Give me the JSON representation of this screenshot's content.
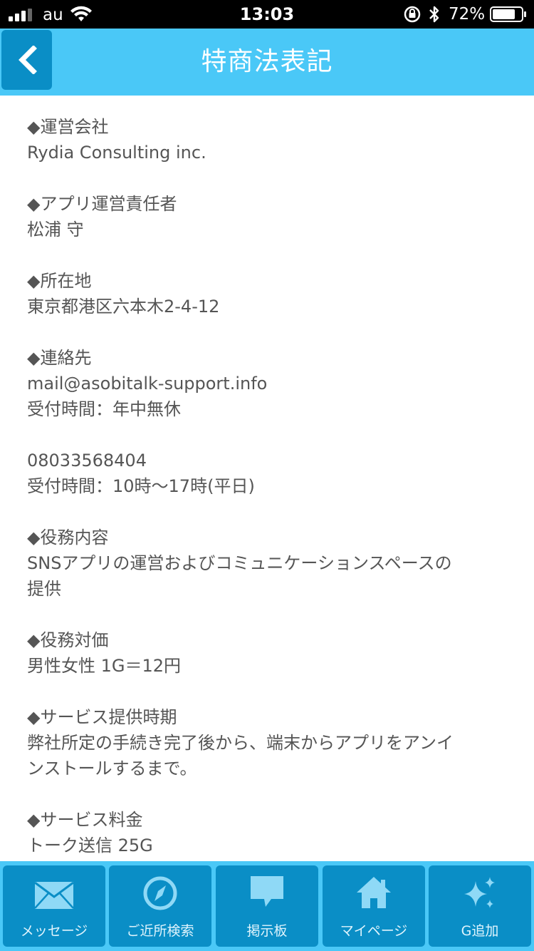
{
  "status_bar": {
    "carrier": "au",
    "time": "13:03",
    "battery_percent": "72%"
  },
  "header": {
    "title": "特商法表記"
  },
  "sections": [
    {
      "heading": "◆運営会社",
      "lines": [
        "Rydia Consulting inc."
      ]
    },
    {
      "heading": "◆アプリ運営責任者",
      "lines": [
        "松浦 守"
      ]
    },
    {
      "heading": "◆所在地",
      "lines": [
        "東京都港区六本木2-4-12"
      ]
    },
    {
      "heading": "◆連絡先",
      "lines": [
        "mail@asobitalk-support.info",
        "受付時間：年中無休",
        "",
        "08033568404",
        "受付時間：10時〜17時(平日)"
      ]
    },
    {
      "heading": "◆役務内容",
      "lines": [
        "SNSアプリの運営およびコミュニケーションスペースの",
        "提供"
      ]
    },
    {
      "heading": "◆役務対価",
      "lines": [
        "男性女性 1G＝12円"
      ]
    },
    {
      "heading": "◆サービス提供時期",
      "lines": [
        "弊社所定の手続き完了後から、端末からアプリをアンイ",
        "ンストールするまで。"
      ]
    },
    {
      "heading": "◆サービス料金",
      "lines": [
        "トーク送信 25G"
      ]
    }
  ],
  "tabs": [
    {
      "label": "メッセージ",
      "icon": "envelope-icon"
    },
    {
      "label": "ご近所検索",
      "icon": "compass-icon"
    },
    {
      "label": "掲示板",
      "icon": "speech-bubble-icon"
    },
    {
      "label": "マイページ",
      "icon": "home-icon"
    },
    {
      "label": "G追加",
      "icon": "sparkle-icon"
    }
  ],
  "colors": {
    "header_bg": "#4ac8f7",
    "button_bg": "#0a8ec6",
    "text": "#555555"
  }
}
